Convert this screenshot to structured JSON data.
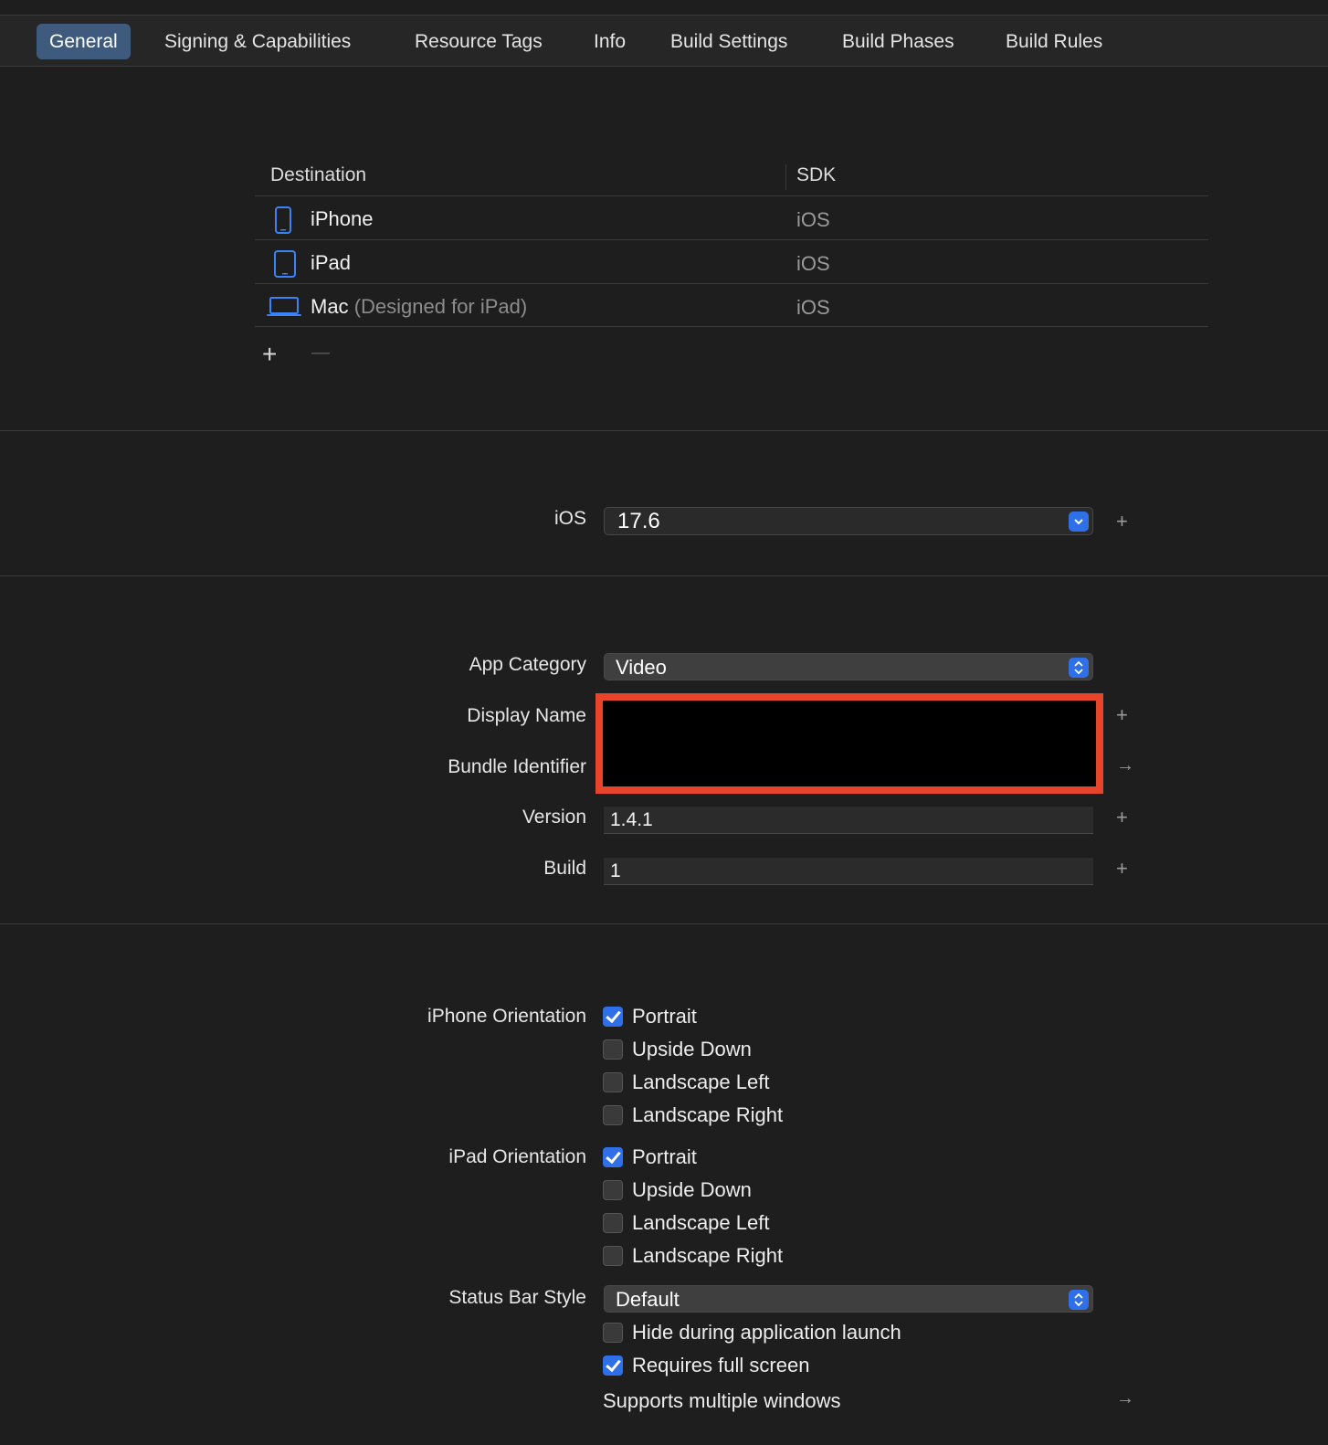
{
  "tabs": [
    "General",
    "Signing & Capabilities",
    "Resource Tags",
    "Info",
    "Build Settings",
    "Build Phases",
    "Build Rules"
  ],
  "destinations": {
    "header_destination": "Destination",
    "header_sdk": "SDK",
    "rows": [
      {
        "name": "iPhone",
        "sub": "",
        "sdk": "iOS",
        "icon": "iphone-icon"
      },
      {
        "name": "iPad",
        "sub": "",
        "sdk": "iOS",
        "icon": "ipad-icon"
      },
      {
        "name": "Mac",
        "sub": "(Designed for iPad)",
        "sdk": "iOS",
        "icon": "laptop-icon"
      }
    ],
    "add_symbol": "+",
    "remove_symbol": "—"
  },
  "deployment": {
    "label": "iOS",
    "value": "17.6"
  },
  "identity": {
    "app_category_label": "App Category",
    "app_category_value": "Video",
    "display_name_label": "Display Name",
    "bundle_identifier_label": "Bundle Identifier",
    "version_label": "Version",
    "version_value": "1.4.1",
    "build_label": "Build",
    "build_value": "1"
  },
  "deployment_info": {
    "iphone_orientation_label": "iPhone Orientation",
    "iphone_orientation": [
      {
        "label": "Portrait",
        "checked": true
      },
      {
        "label": "Upside Down",
        "checked": false
      },
      {
        "label": "Landscape Left",
        "checked": false
      },
      {
        "label": "Landscape Right",
        "checked": false
      }
    ],
    "ipad_orientation_label": "iPad Orientation",
    "ipad_orientation": [
      {
        "label": "Portrait",
        "checked": true
      },
      {
        "label": "Upside Down",
        "checked": false
      },
      {
        "label": "Landscape Left",
        "checked": false
      },
      {
        "label": "Landscape Right",
        "checked": false
      }
    ],
    "status_bar_style_label": "Status Bar Style",
    "status_bar_style_value": "Default",
    "hide_during_launch": {
      "label": "Hide during application launch",
      "checked": false
    },
    "requires_full_screen": {
      "label": "Requires full screen",
      "checked": true
    },
    "supports_multiple_windows": "Supports multiple windows"
  },
  "colors": {
    "accent": "#2f6fe8",
    "active_tab": "#3e5a7c",
    "redaction_border": "#e8432b"
  }
}
